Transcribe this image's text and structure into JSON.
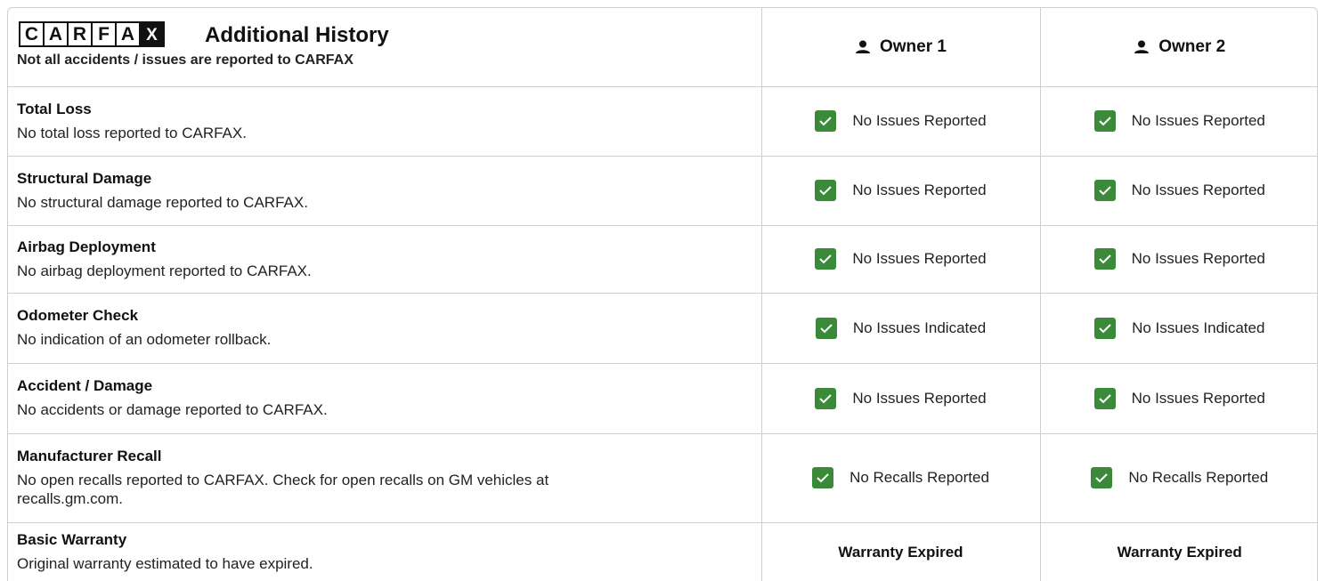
{
  "header": {
    "logo_letters": [
      "C",
      "A",
      "R",
      "F",
      "A",
      "X"
    ],
    "title": "Additional History",
    "subtitle": "Not all accidents / issues are reported to CARFAX",
    "owners": [
      "Owner 1",
      "Owner 2"
    ]
  },
  "rows": [
    {
      "title": "Total Loss",
      "desc": "No total loss reported to CARFAX.",
      "owner1": "No Issues Reported",
      "owner2": "No Issues Reported"
    },
    {
      "title": "Structural Damage",
      "desc": "No structural damage reported to CARFAX.",
      "owner1": "No Issues Reported",
      "owner2": "No Issues Reported"
    },
    {
      "title": "Airbag Deployment",
      "desc": "No airbag deployment reported to CARFAX.",
      "owner1": "No Issues Reported",
      "owner2": "No Issues Reported"
    },
    {
      "title": "Odometer Check",
      "desc": "No indication of an odometer rollback.",
      "owner1": "No Issues Indicated",
      "owner2": "No Issues Indicated"
    },
    {
      "title": "Accident / Damage",
      "desc": "No accidents or damage reported to CARFAX.",
      "owner1": "No Issues Reported",
      "owner2": "No Issues Reported"
    },
    {
      "title": "Manufacturer Recall",
      "desc_line1": "No open recalls reported to CARFAX. Check for open recalls on GM vehicles at",
      "desc_line2": "recalls.gm.com.",
      "owner1": "No Recalls Reported",
      "owner2": "No Recalls Reported"
    },
    {
      "title": "Basic Warranty",
      "desc": "Original warranty estimated to have expired.",
      "owner1": "Warranty Expired",
      "owner2": "Warranty Expired"
    }
  ],
  "colors": {
    "check_green": "#3a8a3a",
    "border": "#cfcfcf",
    "text": "#222222"
  },
  "icons": {
    "owner": "user-icon",
    "status": "checkmark-icon"
  }
}
